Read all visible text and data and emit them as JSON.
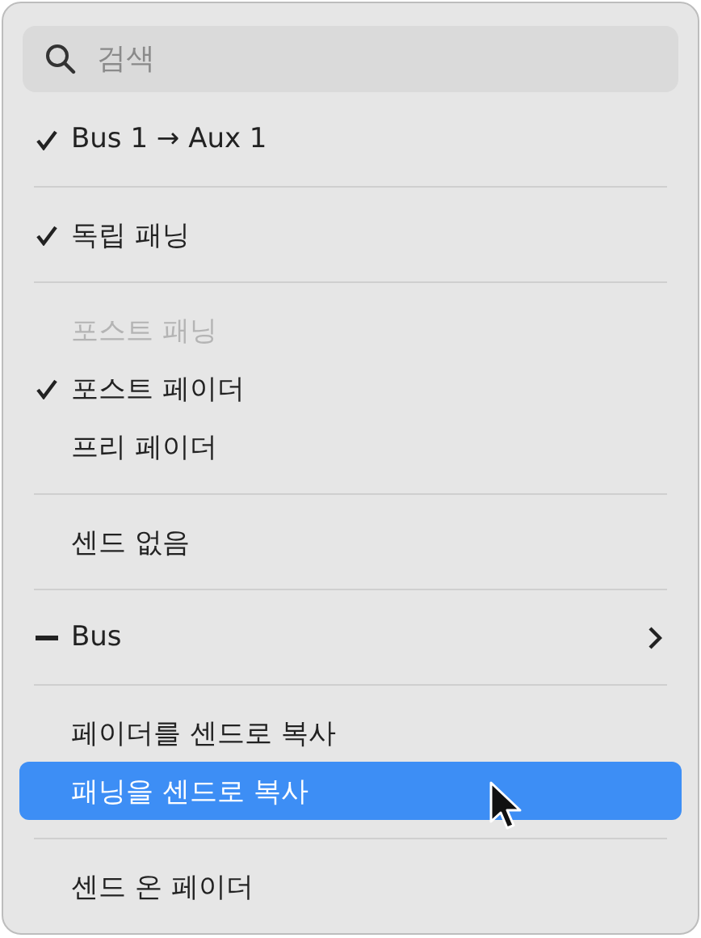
{
  "search": {
    "placeholder": "검색"
  },
  "groups": [
    {
      "items": [
        {
          "label": "Bus 1 → Aux 1",
          "kind": "check",
          "disabled": false,
          "selected": false,
          "submenu": false
        }
      ]
    },
    {
      "items": [
        {
          "label": "독립 패닝",
          "kind": "check",
          "disabled": false,
          "selected": false,
          "submenu": false
        }
      ]
    },
    {
      "items": [
        {
          "label": "포스트 패닝",
          "kind": "plain",
          "disabled": true,
          "selected": false,
          "submenu": false
        },
        {
          "label": "포스트 페이더",
          "kind": "check",
          "disabled": false,
          "selected": false,
          "submenu": false
        },
        {
          "label": "프리 페이더",
          "kind": "plain",
          "disabled": false,
          "selected": false,
          "submenu": false
        }
      ]
    },
    {
      "items": [
        {
          "label": "센드 없음",
          "kind": "plain",
          "disabled": false,
          "selected": false,
          "submenu": false
        }
      ]
    },
    {
      "items": [
        {
          "label": "Bus",
          "kind": "dash",
          "disabled": false,
          "selected": false,
          "submenu": true
        }
      ]
    },
    {
      "items": [
        {
          "label": "페이더를 센드로 복사",
          "kind": "plain",
          "disabled": false,
          "selected": false,
          "submenu": false
        },
        {
          "label": "패닝을 센드로 복사",
          "kind": "plain",
          "disabled": false,
          "selected": true,
          "submenu": false
        }
      ]
    },
    {
      "items": [
        {
          "label": "센드 온 페이더",
          "kind": "plain",
          "disabled": false,
          "selected": false,
          "submenu": false
        }
      ]
    }
  ]
}
